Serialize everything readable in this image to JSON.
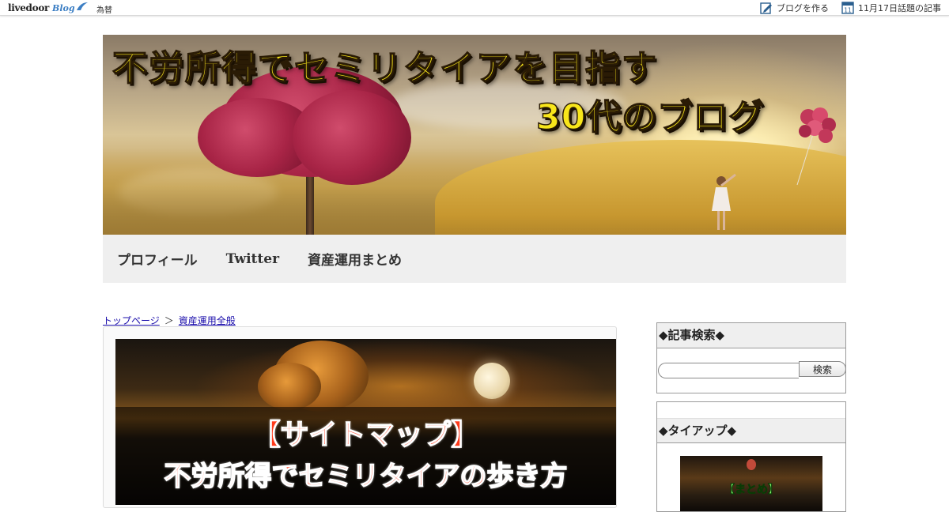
{
  "topbar": {
    "logo_word": "livedoor",
    "logo_blog": "Blog",
    "kawase": "為替",
    "create_blog": "ブログを作る",
    "topic_date_badge": "11",
    "topic_articles": "11月17日話題の記事"
  },
  "banner": {
    "title": "不労所得でセミリタイアを目指す",
    "subtitle": "30代のブログ"
  },
  "nav": {
    "items": [
      {
        "label": "プロフィール"
      },
      {
        "label": "Twitter"
      },
      {
        "label": "資産運用まとめ"
      }
    ]
  },
  "breadcrumb": {
    "home": "トップページ",
    "separator": "＞",
    "category": "資産運用全般"
  },
  "article": {
    "eyecatch_line1": "【サイトマップ】",
    "eyecatch_line2": "不労所得でセミリタイアの歩き方"
  },
  "sidebar": {
    "search": {
      "heading": "◆記事検索◆",
      "placeholder": "",
      "button": "検索"
    },
    "tieup": {
      "heading": "◆タイアップ◆",
      "image_label": "【まとめ】"
    }
  },
  "colors": {
    "banner_text": "#f8e61a",
    "eyecatch_text": "#ff3a1a",
    "link": "#1a0dab",
    "nav_bg": "#efefef"
  },
  "icons": {
    "create_blog": "pencil-note-icon",
    "topics": "calendar-icon",
    "search": "magnifier-icon"
  }
}
